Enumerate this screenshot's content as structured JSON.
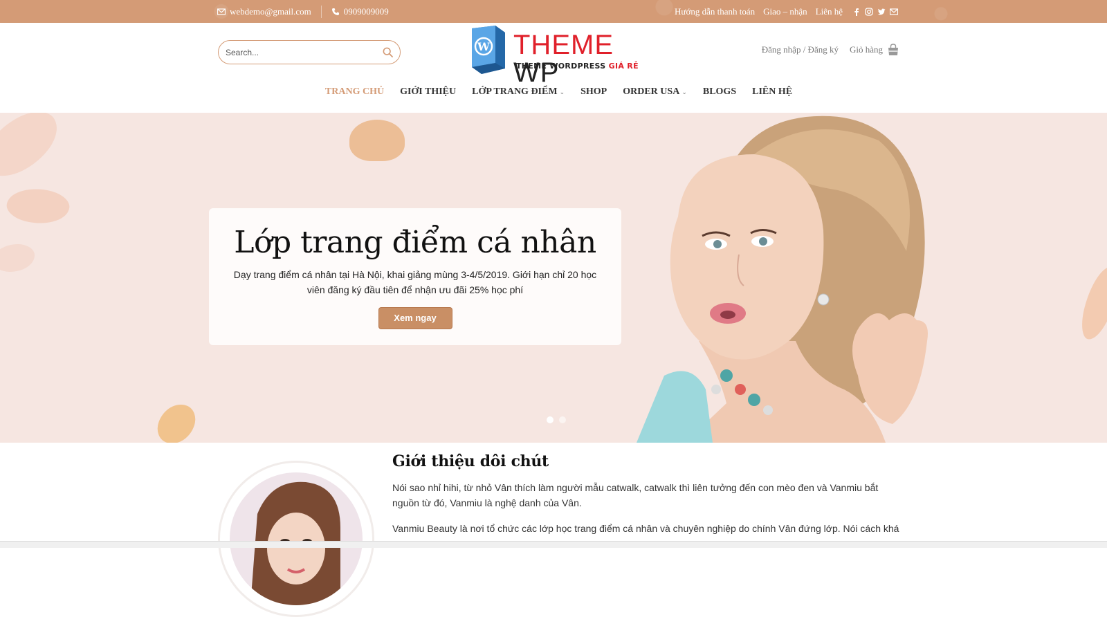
{
  "topbar": {
    "email": "webdemo@gmail.com",
    "phone": "0909009009",
    "links": [
      "Hướng dẫn thanh toán",
      "Giao – nhận",
      "Liên hệ"
    ],
    "socials": [
      "facebook-icon",
      "instagram-icon",
      "twitter-icon",
      "mail-icon"
    ]
  },
  "header": {
    "search_placeholder": "Search...",
    "logo": {
      "word1": "THEME",
      "word2": "WP",
      "tag_main": "THEME WORDPRESS",
      "tag_red": "GIÁ RẺ"
    },
    "account": "Đăng nhập / Đăng ký",
    "cart": "Giỏ hàng"
  },
  "nav": {
    "items": [
      {
        "label": "TRANG CHỦ",
        "active": true
      },
      {
        "label": "GIỚI THIỆU"
      },
      {
        "label": "LỚP TRANG ĐIỂM",
        "dropdown": true
      },
      {
        "label": "SHOP"
      },
      {
        "label": "ORDER USA",
        "dropdown": true
      },
      {
        "label": "BLOGS"
      },
      {
        "label": "LIÊN HỆ"
      }
    ]
  },
  "hero": {
    "title": "Lớp trang điểm cá nhân",
    "text": "Dạy trang điểm cá nhân tại Hà Nội, khai giảng mùng 3-4/5/2019. Giới hạn chỉ 20 học viên đăng ký đầu tiên để nhận ưu đãi 25% học phí",
    "button": "Xem ngay",
    "slides": 2,
    "active_slide": 1
  },
  "about": {
    "title": "Giới thiệu dôi chút",
    "p1": "Nói sao nhỉ hihi, từ nhỏ Vân thích làm người mẫu catwalk, catwalk thì liên tưởng đến con mèo đen và Vanmiu bắt nguồn từ đó, Vanmiu là nghệ danh của Vân.",
    "p2": "Vanmiu Beauty là nơi tổ chức các lớp học trang điểm cá nhân và chuyên nghiệp do chính Vân đứng lớp. Nói cách khác"
  },
  "colors": {
    "accent": "#d49b76",
    "hero_bg": "#f6e6e1",
    "button": "#c98f65"
  }
}
